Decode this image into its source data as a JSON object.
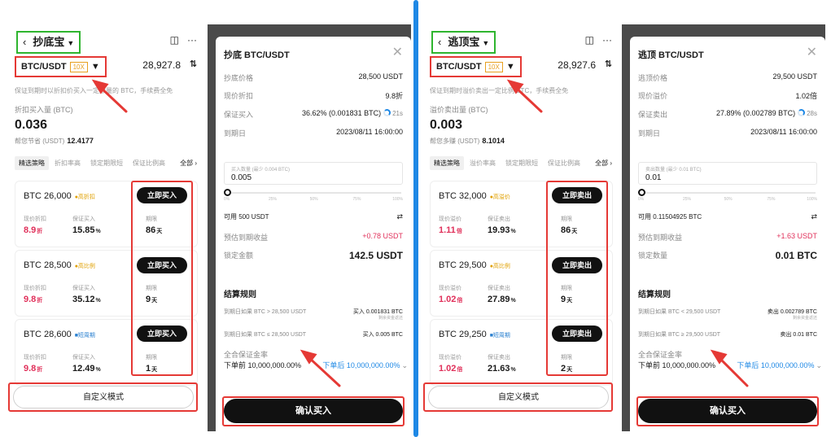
{
  "left_panel": {
    "header": {
      "back_glyph": "‹",
      "title": "抄底宝",
      "dropdown_glyph": "▼",
      "book_glyph": "◫",
      "more_glyph": "···"
    },
    "pair": {
      "symbol": "BTC/USDT",
      "leverage": "10X",
      "caret": "▼",
      "price": "28,927.8",
      "price_icon": "⇅"
    },
    "description": "保证到期时以折扣价买入一定数量的 BTC，手续费全免",
    "amount_label": "折扣买入量 (BTC)",
    "amount_value": "0.036",
    "save_label": "帮您节省 (USDT)",
    "save_value": "12.4177",
    "tabs": [
      "精选策略",
      "折扣率高",
      "锁定期限短",
      "保证比例高"
    ],
    "tab_all": "全部 ›",
    "stat_labels": {
      "a": "现价折扣",
      "b": "保证买入",
      "c": "期限"
    },
    "cards": [
      {
        "title": "BTC 26,000",
        "badge": "●高折扣",
        "badge_color": "gold",
        "v1": "8.9",
        "u1": "折",
        "v2": "15.85",
        "u2": "%",
        "v3": "86",
        "u3": "天",
        "action": "立即买入"
      },
      {
        "title": "BTC 28,500",
        "badge": "●高比例",
        "badge_color": "gold",
        "v1": "9.8",
        "u1": "折",
        "v2": "35.12",
        "u2": "%",
        "v3": "9",
        "u3": "天",
        "action": "立即买入"
      },
      {
        "title": "BTC 28,600",
        "badge": "■短周期",
        "badge_color": "blue",
        "v1": "9.8",
        "u1": "折",
        "v2": "12.49",
        "u2": "%",
        "v3": "1",
        "u3": "天",
        "action": "立即买入"
      }
    ],
    "custom_mode": "自定义模式"
  },
  "left_dialog": {
    "title": "抄底 BTC/USDT",
    "close_glyph": "✕",
    "rows": [
      {
        "k": "抄底价格",
        "v": "28,500 USDT"
      },
      {
        "k": "现价折扣",
        "v": "9.8折"
      },
      {
        "k": "保证买入",
        "v": "36.62% (0.001831 BTC)",
        "timer": "21s"
      },
      {
        "k": "到期日",
        "v": "2023/08/11 16:00:00"
      }
    ],
    "input_placeholder": "买入数量 (最少 0.004 BTC)",
    "input_value": "0.005",
    "slider_percent": 0,
    "tick_labels": [
      "0%",
      "25%",
      "50%",
      "75%",
      "100%"
    ],
    "available": "可用 500 USDT",
    "swap_glyph": "⇄",
    "expected_label": "预估到期收益",
    "expected_value": "+0.78 USDT",
    "locked_label": "锁定金额",
    "locked_value": "142.5 USDT",
    "settle_title": "结算规则",
    "rule1_k": "到期日如果 BTC > 28,500 USDT",
    "rule1_v": "买入 0.001831 BTC",
    "rule1_sub": "剩余资金返还",
    "rule2_k": "到期日如果 BTC ≤ 28,500 USDT",
    "rule2_v": "买入 0.005 BTC",
    "rate_label": "全合保证金率",
    "rate_before": "下单前 10,000,000.00%",
    "rate_after": "下单后 10,000,000.00%",
    "rate_chev": "⌄",
    "confirm": "确认买入"
  },
  "right_panel": {
    "header": {
      "back_glyph": "‹",
      "title": "逃顶宝",
      "dropdown_glyph": "▼",
      "book_glyph": "◫",
      "more_glyph": "···"
    },
    "pair": {
      "symbol": "BTC/USDT",
      "leverage": "10X",
      "caret": "▼",
      "price": "28,927.6",
      "price_icon": "⇅"
    },
    "description": "保证到期时溢价卖出一定比例 BTC，手续费全免",
    "amount_label": "溢价卖出量 (BTC)",
    "amount_value": "0.003",
    "save_label": "帮您多赚 (USDT)",
    "save_value": "8.1014",
    "tabs": [
      "精选策略",
      "溢价率高",
      "锁定期限短",
      "保证比例高"
    ],
    "tab_all": "全部 ›",
    "stat_labels": {
      "a": "现价溢价",
      "b": "保证卖出",
      "c": "期限"
    },
    "cards": [
      {
        "title": "BTC 32,000",
        "badge": "●高溢价",
        "badge_color": "gold",
        "v1": "1.11",
        "u1": "倍",
        "v2": "19.93",
        "u2": "%",
        "v3": "86",
        "u3": "天",
        "action": "立即卖出"
      },
      {
        "title": "BTC 29,500",
        "badge": "●高比例",
        "badge_color": "gold",
        "v1": "1.02",
        "u1": "倍",
        "v2": "27.89",
        "u2": "%",
        "v3": "9",
        "u3": "天",
        "action": "立即卖出"
      },
      {
        "title": "BTC 29,250",
        "badge": "■短周期",
        "badge_color": "blue",
        "v1": "1.02",
        "u1": "倍",
        "v2": "21.63",
        "u2": "%",
        "v3": "2",
        "u3": "天",
        "action": "立即卖出"
      }
    ],
    "custom_mode": "自定义模式"
  },
  "right_dialog": {
    "title": "逃顶 BTC/USDT",
    "close_glyph": "✕",
    "rows": [
      {
        "k": "逃顶价格",
        "v": "29,500 USDT"
      },
      {
        "k": "现价溢价",
        "v": "1.02倍"
      },
      {
        "k": "保证卖出",
        "v": "27.89% (0.002789 BTC)",
        "timer": "28s"
      },
      {
        "k": "到期日",
        "v": "2023/08/11 16:00:00"
      }
    ],
    "input_placeholder": "卖出数量 (最少 0.01 BTC)",
    "input_value": "0.01",
    "slider_percent": 0,
    "tick_labels": [
      "0%",
      "25%",
      "50%",
      "75%",
      "100%"
    ],
    "available": "可用 0.11504925 BTC",
    "swap_glyph": "⇄",
    "expected_label": "预估到期收益",
    "expected_value": "+1.63 USDT",
    "locked_label": "锁定数量",
    "locked_value": "0.01 BTC",
    "settle_title": "结算规则",
    "rule1_k": "到期日如果 BTC < 29,500 USDT",
    "rule1_v": "卖出 0.002789 BTC",
    "rule1_sub": "剩余资金返还",
    "rule2_k": "到期日如果 BTC ≥ 29,500 USDT",
    "rule2_v": "卖出 0.01 BTC",
    "rate_label": "全合保证金率",
    "rate_before": "下单前 10,000,000.00%",
    "rate_after": "下单后 10,000,000.00%",
    "rate_chev": "⌄",
    "confirm": "确认买入"
  },
  "colors": {
    "highlight_green": "#2fb52f",
    "highlight_red": "#e53935",
    "accent_blue": "#1e88e5",
    "positive_pink": "#e0305a",
    "badge_gold": "#e0a000"
  }
}
